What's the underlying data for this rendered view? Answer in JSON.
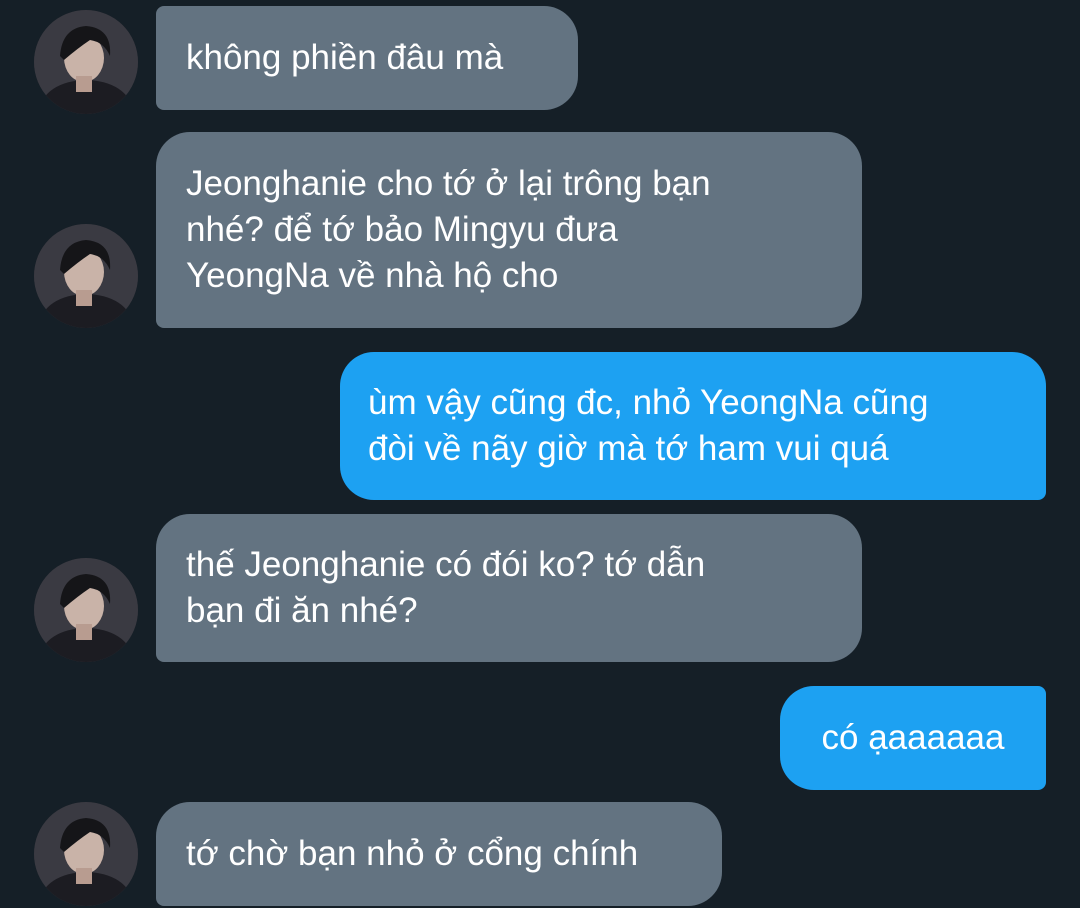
{
  "messages": [
    {
      "sender": "other",
      "lines": [
        "không phiền đâu mà"
      ]
    },
    {
      "sender": "other",
      "lines": [
        "Jeonghanie cho tớ ở lại trông bạn",
        "nhé? để tớ bảo Mingyu đưa",
        "YeongNa về nhà hộ cho"
      ]
    },
    {
      "sender": "self",
      "lines": [
        "ùm vậy cũng đc, nhỏ YeongNa cũng",
        "đòi về nãy giờ mà tớ ham vui quá"
      ]
    },
    {
      "sender": "other",
      "lines": [
        "thế Jeonghanie có đói ko? tớ dẫn",
        "bạn đi ăn nhé?"
      ]
    },
    {
      "sender": "self",
      "lines": [
        "có ạaaaaaa"
      ]
    },
    {
      "sender": "other",
      "lines": [
        "tớ chờ bạn nhỏ ở cổng chính"
      ]
    }
  ],
  "avatar_icon": "profile-photo-icon",
  "colors": {
    "background": "#151f27",
    "incoming_bubble": "#637381",
    "outgoing_bubble": "#1da1f2",
    "text": "#ffffff"
  }
}
